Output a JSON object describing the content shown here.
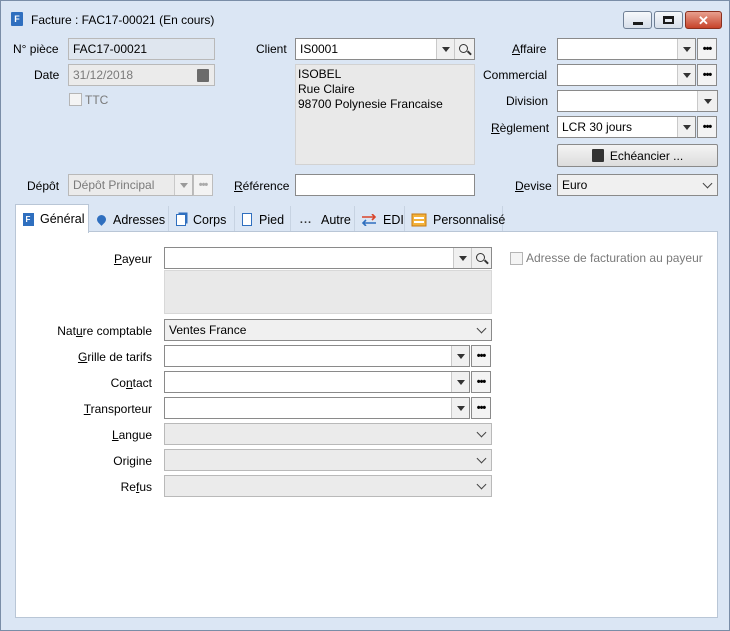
{
  "window": {
    "title": "Facture : FAC17-00021 (En cours)",
    "icon_letter": "F"
  },
  "header": {
    "no_piece": {
      "label": "N° pièce",
      "value": "FAC17-00021"
    },
    "date": {
      "label": "Date",
      "value": "31/12/2018"
    },
    "ttc": {
      "label": "TTC",
      "checked": false
    },
    "client": {
      "label": "Client",
      "value": "IS0001"
    },
    "client_address": [
      "ISOBEL",
      "Rue Claire",
      "98700 Polynesie Francaise"
    ],
    "affaire": {
      "label": "Affaire",
      "value": ""
    },
    "commercial": {
      "label": "Commercial",
      "value": ""
    },
    "division": {
      "label": "Division",
      "value": ""
    },
    "reglement": {
      "label": "Règlement",
      "value": "LCR 30 jours"
    },
    "echeancier_button": "Echéancier ...",
    "depot": {
      "label": "Dépôt",
      "value": "Dépôt Principal"
    },
    "reference": {
      "label": "Référence",
      "value": ""
    },
    "devise": {
      "label": "Devise",
      "value": "Euro"
    }
  },
  "tabs": [
    {
      "label": "Général",
      "icon": "document-icon",
      "active": true
    },
    {
      "label": "Adresses",
      "icon": "location-pin-icon",
      "active": false
    },
    {
      "label": "Corps",
      "icon": "pages-icon",
      "active": false
    },
    {
      "label": "Pied",
      "icon": "page-icon",
      "active": false
    },
    {
      "label": "Autre",
      "icon": "dots-icon",
      "active": false
    },
    {
      "label": "EDI",
      "icon": "exchange-arrows-icon",
      "active": false
    },
    {
      "label": "Personnalisé",
      "icon": "custom-fields-icon",
      "active": false
    }
  ],
  "general": {
    "payeur": {
      "label": "Payeur",
      "value": ""
    },
    "adresse_facturation_payeur": {
      "label": "Adresse de facturation au payeur",
      "checked": false
    },
    "nature_comptable": {
      "label": "Nature comptable",
      "value": "Ventes France"
    },
    "grille_tarifs": {
      "label": "Grille de tarifs",
      "value": ""
    },
    "contact": {
      "label": "Contact",
      "value": ""
    },
    "transporteur": {
      "label": "Transporteur",
      "value": ""
    },
    "langue": {
      "label": "Langue",
      "value": ""
    },
    "origine": {
      "label": "Origine",
      "value": ""
    },
    "refus": {
      "label": "Refus",
      "value": ""
    }
  },
  "colors": {
    "window_bg": "#dbe6f4",
    "accent": "#2f6fbf",
    "close_button": "#c7432a"
  }
}
